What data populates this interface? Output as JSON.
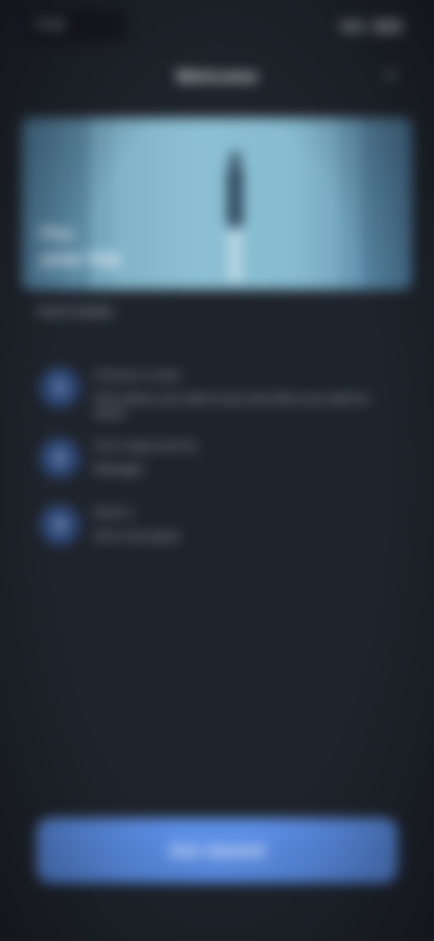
{
  "status_bar": {
    "time": "9:41"
  },
  "header": {
    "title": "Welcome",
    "close_icon": "close-icon"
  },
  "hero": {
    "caption_line1": "Plan",
    "caption_line2": "your trip"
  },
  "subtitle": "How it works",
  "steps": [
    {
      "number": "1",
      "line1": "Choose a route",
      "line2": "Pick where you want to go and when you want to travel"
    },
    {
      "number": "2",
      "line1": "Get it approved by",
      "line2": "Manager"
    },
    {
      "number": "3",
      "line1": "Book it",
      "line2": "All in one place"
    }
  ],
  "cta": {
    "label": "Get started"
  },
  "colors": {
    "background": "#1f242c",
    "accent": "#5b8ee6",
    "step_circle": "#2f4a7a"
  }
}
